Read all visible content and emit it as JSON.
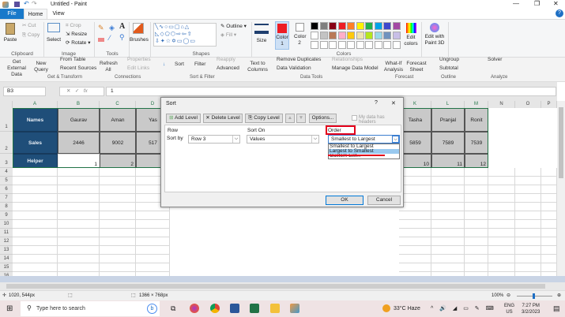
{
  "window": {
    "title": "Untitled - Paint"
  },
  "tabs": [
    "File",
    "Home",
    "View"
  ],
  "ribbon": {
    "paste": "Paste",
    "cut": "Cut",
    "copy": "Copy",
    "clipboard": "Clipboard",
    "select": "Select",
    "crop": "Crop",
    "resize": "Resize",
    "rotate": "Rotate",
    "image": "Image",
    "tools": "Tools",
    "brushes": "Brushes",
    "outline": "Outline",
    "fill": "Fill",
    "shapes": "Shapes",
    "size": "Size",
    "color1": "Color 1",
    "color2": "Color 2",
    "colors": "Colors",
    "edit_colors": "Edit colors",
    "edit_paint3d": "Edit with Paint 3D",
    "palette": [
      "#000000",
      "#7f7f7f",
      "#880015",
      "#ed1c24",
      "#ff7f27",
      "#fff200",
      "#22b14c",
      "#00a2e8",
      "#3f48cc",
      "#a349a4",
      "#ffffff",
      "#c3c3c3",
      "#b97a57",
      "#ffaec9",
      "#ffc90e",
      "#efe4b0",
      "#b5e61d",
      "#99d9ea",
      "#7092be",
      "#c8bfe7"
    ]
  },
  "excel_ribbon": {
    "get_external": "Get External Data",
    "new_query": "New Query",
    "from_table": "From Table",
    "recent_sources": "Recent Sources",
    "get_transform": "Get & Transform",
    "refresh": "Refresh All",
    "properties": "Properties",
    "edit_links": "Edit Links",
    "connections": "Connections",
    "sort": "Sort",
    "filter": "Filter",
    "reapply": "Reapply",
    "advanced": "Advanced",
    "sort_filter": "Sort & Filter",
    "text_to_columns": "Text to Columns",
    "remove_duplicates": "Remove Duplicates",
    "data_validation": "Data Validation",
    "relationships": "Relationships",
    "manage_model": "Manage Data Model",
    "data_tools": "Data Tools",
    "what_if": "What-If Analysis",
    "forecast_sheet": "Forecast Sheet",
    "forecast": "Forecast",
    "ungroup": "Ungroup",
    "subtotal": "Subtotal",
    "outline": "Outline",
    "solver": "Solver",
    "analyze": "Analyze"
  },
  "formula": {
    "name_box": "B3",
    "value": "1"
  },
  "sheet": {
    "columns": [
      "A",
      "B",
      "C",
      "D",
      "K",
      "L",
      "M",
      "N",
      "O",
      "P"
    ],
    "row_labels": [
      "Names",
      "Sales",
      "Helper"
    ],
    "names": [
      "Gaurav",
      "Aman",
      "Yas",
      "Tasha",
      "Pranjal",
      "Ronit"
    ],
    "sales": [
      "2446",
      "9002",
      "517",
      "5859",
      "7589",
      "7539"
    ],
    "helper": [
      "1",
      "2",
      "10",
      "11",
      "12"
    ]
  },
  "dialog": {
    "title": "Sort",
    "help": "?",
    "close": "✕",
    "add_level": "Add Level",
    "delete_level": "Delete Level",
    "copy_level": "Copy Level",
    "options": "Options...",
    "headers_label": "My data has headers",
    "col_row": "Row",
    "col_sort_on": "Sort On",
    "col_order": "Order",
    "sort_by": "Sort by",
    "row_value": "Row 3",
    "sort_on_value": "Values",
    "order_value": "Smallest to Largest",
    "order_options": [
      "Smallest to Largest",
      "Largest to Smallest",
      "Custom List..."
    ],
    "ok": "OK",
    "cancel": "Cancel"
  },
  "status": {
    "cursor": "1020, 544px",
    "size": "1366 × 768px",
    "zoom": "100%"
  },
  "taskbar": {
    "search": "Type here to search",
    "weather": "33°C  Haze",
    "lang1": "ENG",
    "lang2": "US",
    "time": "7:27 PM",
    "date": "3/2/2023"
  }
}
